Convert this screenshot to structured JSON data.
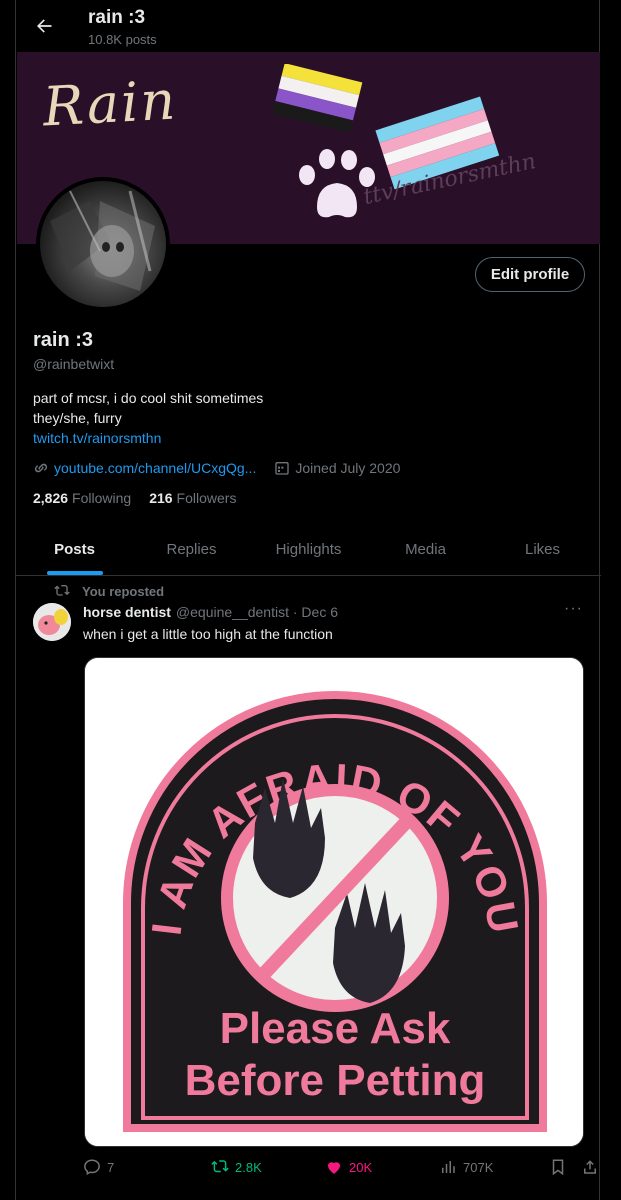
{
  "header": {
    "name": "rain :3",
    "post_count": "10.8K posts"
  },
  "banner": {
    "word": "Rain",
    "handle": "ttv/rainorsmthn"
  },
  "profile": {
    "edit_label": "Edit profile",
    "name": "rain :3",
    "handle": "@rainbetwixt",
    "bio_line1": "part of mcsr, i do cool shit sometimes",
    "bio_line2": "they/she, furry",
    "bio_link": "twitch.tv/rainorsmthn",
    "website": "youtube.com/channel/UCxgQg...",
    "joined": "Joined July 2020",
    "following_count": "2,826",
    "following_label": "Following",
    "followers_count": "216",
    "followers_label": "Followers"
  },
  "tabs": [
    {
      "label": "Posts"
    },
    {
      "label": "Replies"
    },
    {
      "label": "Highlights"
    },
    {
      "label": "Media"
    },
    {
      "label": "Likes"
    }
  ],
  "post": {
    "repost_label": "You reposted",
    "author_name": "horse dentist",
    "author_meta": "@equine__dentist · Dec 6",
    "more": "···",
    "text": "when i get a little too high at the function",
    "media": {
      "arc_text": "I AM AFRAID OF YOU",
      "line1": "Please Ask",
      "line2": "Before Petting"
    },
    "stats": {
      "replies": "7",
      "reposts": "2.8K",
      "likes": "20K",
      "views": "707K"
    }
  },
  "colors": {
    "accent": "#1d9bf0",
    "repost": "#00ba7c",
    "like": "#f91880",
    "muted": "#71767b",
    "banner": "#2a0f28",
    "patch_pink": "#f07a9c"
  },
  "icons": [
    "back-arrow-icon",
    "link-icon",
    "calendar-icon",
    "repost-icon",
    "reply-icon",
    "heart-icon",
    "views-icon",
    "bookmark-icon",
    "share-icon",
    "more-icon"
  ]
}
